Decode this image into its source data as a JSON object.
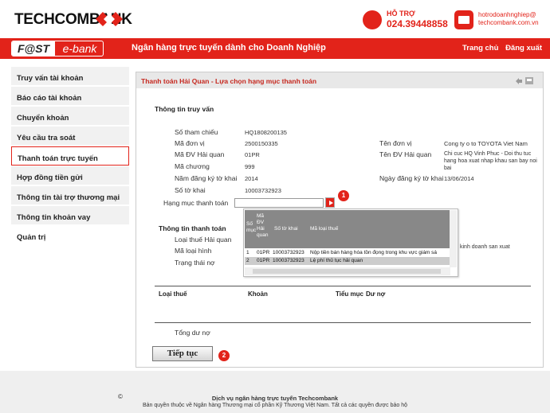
{
  "header": {
    "logo_text": "TECHCOMBANK",
    "hotline_label": "HỖ TRỢ",
    "hotline_number": "024.39448858",
    "email_line1": "hotrodoanhnghiep@",
    "email_line2": "techcombank.com.vn"
  },
  "banner": {
    "fast_label": "F@ST",
    "ebank_label": "e-bank",
    "tagline": "Ngân hàng trực tuyến dành cho Doanh Nghiệp",
    "home_link": "Trang chủ",
    "logout_link": "Đăng xuất"
  },
  "sidebar": {
    "items": [
      {
        "label": "Truy vấn tài khoản"
      },
      {
        "label": "Báo cáo tài khoản"
      },
      {
        "label": "Chuyển khoản"
      },
      {
        "label": "Yêu cầu tra soát"
      },
      {
        "label": "Thanh toán trực tuyến",
        "active": true
      },
      {
        "label": "Hợp đồng tiền gửi"
      },
      {
        "label": "Thông tin tài trợ thương mại"
      },
      {
        "label": "Thông tin khoản vay"
      },
      {
        "label": "Quản trị"
      }
    ]
  },
  "panel": {
    "title": "Thanh toán Hải Quan - Lựa chọn hạng mục thanh toán"
  },
  "query_info": {
    "section_title": "Thông tin truy vấn",
    "ref_label": "Số tham chiếu",
    "ref_value": "HQ1808200135",
    "unit_code_label": "Mã đơn vị",
    "unit_code_value": "2500150335",
    "customs_code_label": "Mã ĐV Hải quan",
    "customs_code_value": "01PR",
    "chapter_label": "Mã chương",
    "chapter_value": "999",
    "year_label": "Năm đăng ký tờ khai",
    "year_value": "2014",
    "decl_no_label": "Số tờ khai",
    "decl_no_value": "10003732923",
    "category_label": "Hạng mục thanh toán",
    "unit_name_label": "Tên đơn vị",
    "unit_name_value": "Cong ty o to TOYOTA Viet Nam",
    "customs_name_label": "Tên ĐV Hải quan",
    "customs_name_value": "Chi cuc HQ Vinh Phuc - Doi thu tuc hang hoa xuat nhap khau san bay noi bai",
    "reg_date_label": "Ngày đăng ký tờ khai",
    "reg_date_value": "13/06/2014"
  },
  "payment_info": {
    "section_title": "Thông tin thanh toán",
    "customs_type_label": "Loại thuế Hải quan",
    "type_code_label": "Mã loại hình",
    "debt_status_label": "Trạng thái nợ",
    "type_desc_value": "kinh doanh san xuat"
  },
  "popup": {
    "headers": [
      "Số mục",
      "Mã ĐV Hải quan",
      "Số tờ khai",
      "Mã loại thuế"
    ],
    "rows": [
      {
        "no": "1",
        "code": "01PR",
        "decl": "10003732923",
        "desc": "Nộp tiền bán hàng hóa tồn đọng trong khu vực giám sá"
      },
      {
        "no": "2",
        "code": "01PR",
        "decl": "10003732923",
        "desc": "Lệ phí thủ tục hải quan"
      }
    ]
  },
  "tax_table": {
    "col_tax_type": "Loại thuế",
    "col_item": "Khoản",
    "col_sub": "Tiểu mục",
    "col_debt": "Dư nợ"
  },
  "total_label": "Tổng dư nợ",
  "continue_label": "Tiếp tục",
  "steps": {
    "step1": "1",
    "step2": "2"
  },
  "footer": {
    "copyright_symbol": "©",
    "line1": "Dịch vụ ngân hàng trực tuyến  Techcombank",
    "line2": "Bản quyền thuộc về  Ngân hàng Thương mại cổ phần Kỹ Thương Việt Nam. Tất cả các quyền được bảo hộ"
  },
  "colors": {
    "brand_red": "#e2231a",
    "sidebar_bg": "#f1f1f1",
    "popup_header": "#888888"
  }
}
